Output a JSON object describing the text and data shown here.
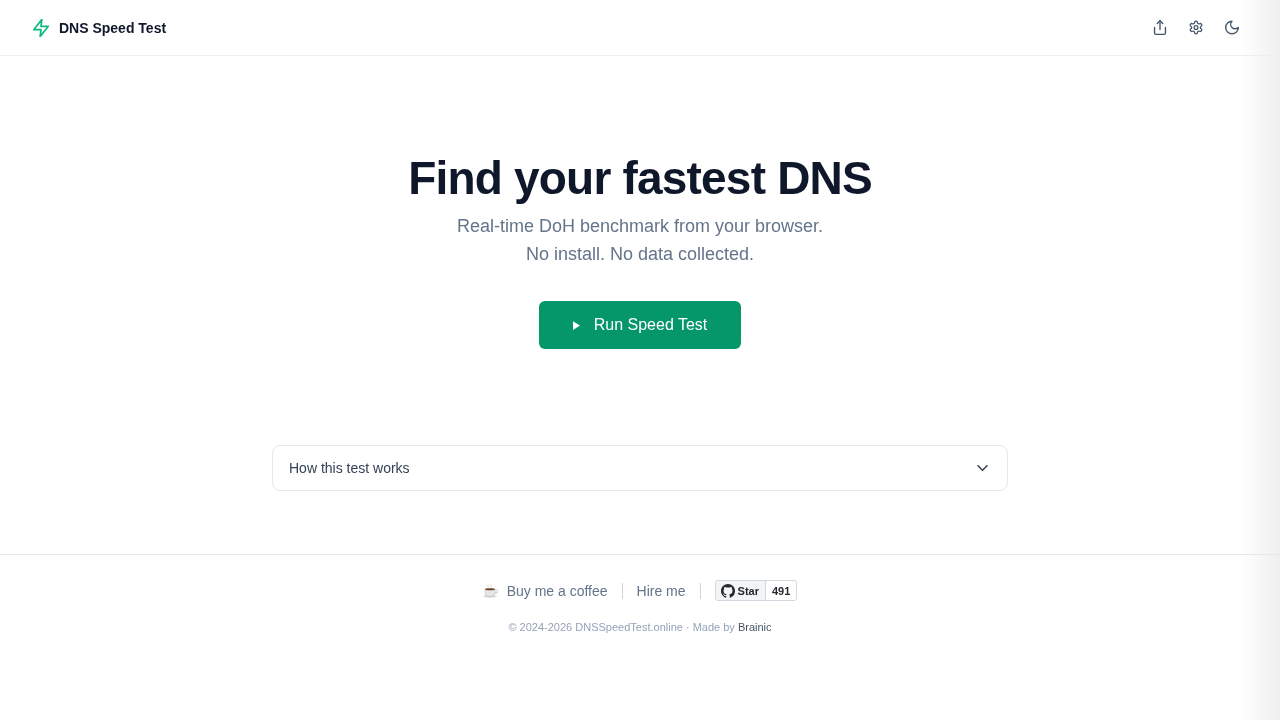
{
  "header": {
    "title": "DNS Speed Test"
  },
  "hero": {
    "title": "Find your fastest DNS",
    "subtitle_lines": [
      "Real-time DoH benchmark from your browser.",
      "No install. No data collected."
    ],
    "run_button": "Run Speed Test"
  },
  "accordion": {
    "label": "How this test works",
    "expanded": false
  },
  "footer": {
    "links": [
      "Buy me a coffee",
      "Hire me"
    ],
    "github": {
      "label": "Star",
      "count": "491"
    },
    "copyright": "© 2024-2026 DNSSpeedTest.online · Made by",
    "author": "Brainic"
  }
}
